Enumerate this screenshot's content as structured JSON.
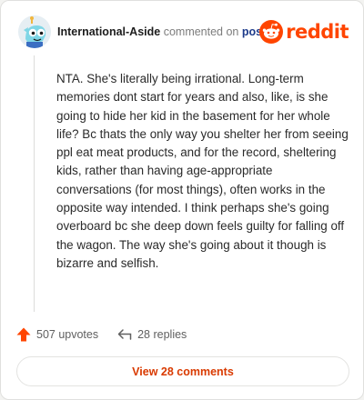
{
  "header": {
    "username": "International-Aside",
    "commented_on": "commented on",
    "post_link": "post",
    "brand": "reddit"
  },
  "comment": {
    "body": "NTA. She's literally being irrational. Long-term memories dont start for years and also, like, is she going to hide her kid in the basement for her whole life? Bc thats the only way you shelter her from seeing ppl eat meat products, and for the record, sheltering kids, rather than having age-appropriate conversations (for most things), often works in the opposite way intended. I think perhaps she's going overboard bc she deep down feels guilty for falling off the wagon. The way she's going about it though is bizarre and selfish."
  },
  "actions": {
    "upvotes": "507 upvotes",
    "replies": "28 replies"
  },
  "footer": {
    "view_comments": "View 28 comments"
  },
  "colors": {
    "accent": "#ff4500",
    "link": "#1c3a8a",
    "button_text": "#d93a00"
  },
  "icons": [
    "avatar",
    "reddit-snoo-icon",
    "upvote-arrow-icon",
    "reply-arrow-icon"
  ]
}
